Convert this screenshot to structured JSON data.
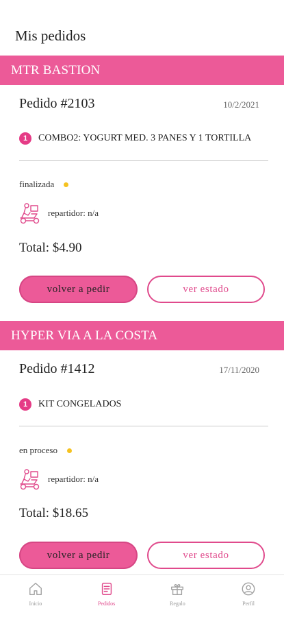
{
  "page": {
    "title": "Mis pedidos"
  },
  "orders": [
    {
      "store": "MTR BASTION",
      "order_number": "Pedido #2103",
      "date": "10/2/2021",
      "item_count": "1",
      "item_name": "COMBO2: YOGURT MED. 3 PANES Y 1 TORTILLA",
      "status": "finalizada",
      "rider": "repartidor: n/a",
      "total": "Total: $4.90",
      "reorder_label": "volver a pedir",
      "status_label": "ver estado"
    },
    {
      "store": "HYPER VIA A LA COSTA",
      "order_number": "Pedido #1412",
      "date": "17/11/2020",
      "item_count": "1",
      "item_name": "KIT CONGELADOS",
      "status": "en proceso",
      "rider": "repartidor: n/a",
      "total": "Total: $18.65",
      "reorder_label": "volver a pedir",
      "status_label": "ver estado"
    }
  ],
  "nav": {
    "items": [
      {
        "label": "Inicio",
        "icon": "home-icon",
        "active": false
      },
      {
        "label": "Pedidos",
        "icon": "orders-icon",
        "active": true
      },
      {
        "label": "Regalo",
        "icon": "gift-icon",
        "active": false
      },
      {
        "label": "Perfil",
        "icon": "profile-icon",
        "active": false
      }
    ]
  },
  "colors": {
    "accent": "#ec5a98",
    "accent_dark": "#e04a8c",
    "status_dot": "#f5c220"
  }
}
